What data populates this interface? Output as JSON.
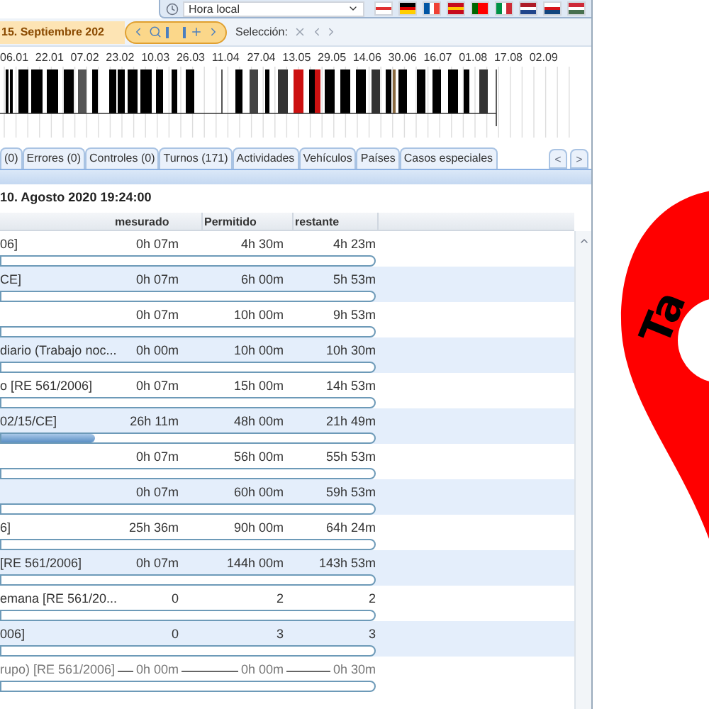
{
  "toolbar": {
    "timezone": "Hora local"
  },
  "period": {
    "date": "15. Septiembre 202",
    "selection_label": "Selección:"
  },
  "timeline": {
    "dates": [
      "06.01",
      "22.01",
      "07.02",
      "23.02",
      "10.03",
      "26.03",
      "11.04",
      "27.04",
      "13.05",
      "29.05",
      "14.06",
      "30.06",
      "16.07",
      "01.08",
      "17.08",
      "02.09"
    ]
  },
  "tabs": [
    {
      "label": "(0)",
      "selected": false
    },
    {
      "label": "Errores (0)",
      "selected": false
    },
    {
      "label": "Controles (0)",
      "selected": false
    },
    {
      "label": "Turnos (171)",
      "selected": false
    },
    {
      "label": "Actividades",
      "selected": false
    },
    {
      "label": "Vehículos",
      "selected": false
    },
    {
      "label": "Países",
      "selected": false
    },
    {
      "label": "Casos especiales",
      "selected": false
    }
  ],
  "tab_scroll": [
    "<",
    ">"
  ],
  "report": {
    "title": "10. Agosto 2020 19:24:00",
    "columns": [
      "mesurado",
      "Permitido",
      "restante"
    ],
    "rows": [
      {
        "label": "06]",
        "measured": "0h 07m",
        "allowed": "4h 30m",
        "remaining": "4h 23m",
        "disabled": false
      },
      {
        "label": "CE]",
        "measured": "0h 07m",
        "allowed": "6h 00m",
        "remaining": "5h 53m",
        "disabled": false
      },
      {
        "measured": "0h 07m",
        "allowed": "10h 00m",
        "remaining": "9h 53m",
        "disabled": false
      },
      {
        "label": "diario (Trabajo noc...",
        "measured": "0h 00m",
        "allowed": "10h 00m",
        "remaining": "10h 30m",
        "disabled": false
      },
      {
        "label": "o [RE 561/2006]",
        "measured": "0h 07m",
        "allowed": "15h 00m",
        "remaining": "14h 53m",
        "disabled": false
      },
      {
        "label": "02/15/CE]",
        "measured": "26h 11m",
        "allowed": "48h 00m",
        "remaining": "21h 49m",
        "level": 0.25,
        "disabled": false
      },
      {
        "measured": "0h 07m",
        "allowed": "56h 00m",
        "remaining": "55h 53m",
        "disabled": false
      },
      {
        "measured": "0h 07m",
        "allowed": "60h 00m",
        "remaining": "59h 53m",
        "disabled": false
      },
      {
        "label": "6]",
        "measured": "25h 36m",
        "allowed": "90h 00m",
        "remaining": "64h 24m",
        "disabled": false
      },
      {
        "label": "[RE 561/2006]",
        "measured": "0h 07m",
        "allowed": "144h 00m",
        "remaining": "143h 53m",
        "disabled": false
      },
      {
        "label": "emana [RE 561/20...",
        "measured": "0",
        "allowed": "2",
        "remaining": "2",
        "disabled": false
      },
      {
        "label": "006]",
        "measured": "0",
        "allowed": "3",
        "remaining": "3",
        "disabled": false
      },
      {
        "label": "rupo) [RE 561/2006]",
        "measured": "0h 00m",
        "allowed": "0h 00m",
        "remaining": "0h 30m",
        "disabled": true
      }
    ]
  },
  "logo": {
    "text": "Ta"
  }
}
